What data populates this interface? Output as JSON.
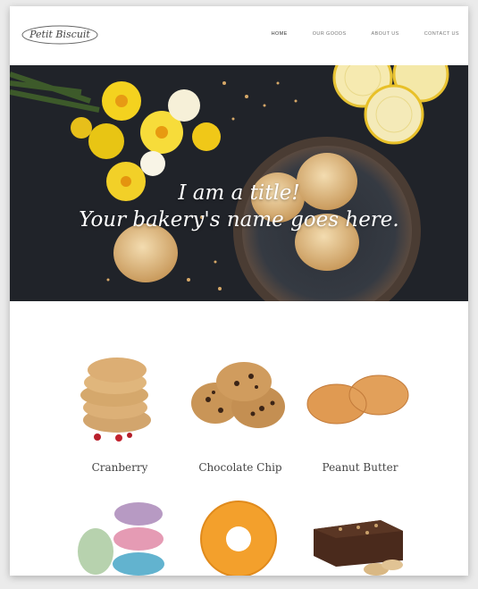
{
  "brand": {
    "logo_text": "Petit Biscuit"
  },
  "nav": {
    "items": [
      {
        "label": "HOME",
        "active": true
      },
      {
        "label": "OUR GOODS",
        "active": false
      },
      {
        "label": "ABOUT US",
        "active": false
      },
      {
        "label": "CONTACT US",
        "active": false
      }
    ]
  },
  "hero": {
    "title_line1": "I am a title!",
    "title_line2": "Your bakery's name goes here."
  },
  "products": {
    "row1": [
      {
        "name": "Cranberry"
      },
      {
        "name": "Chocolate Chip"
      },
      {
        "name": "Peanut Butter"
      }
    ]
  },
  "colors": {
    "hero_bg": "#23262c",
    "page_bg": "#ffffff",
    "text": "#444444"
  }
}
